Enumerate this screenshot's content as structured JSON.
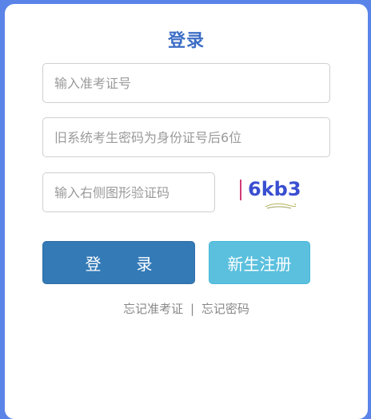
{
  "login_form": {
    "title": "登录",
    "ticket_placeholder": "输入准考证号",
    "password_placeholder": "旧系统考生密码为身份证号后6位",
    "captcha_placeholder": "输入右侧图形验证码",
    "captcha_text": "6kb3",
    "login_button": {
      "char1": "登",
      "char2": "录"
    },
    "register_button": "新生注册",
    "forgot_ticket": "忘记准考证",
    "separator": "|",
    "forgot_password": "忘记密码"
  },
  "colors": {
    "page_bg": "#5b84e9",
    "title": "#3d6ec5",
    "login_button": "#337ab7",
    "register_button": "#5bc0de",
    "captcha_text": "#3a4fd0"
  }
}
